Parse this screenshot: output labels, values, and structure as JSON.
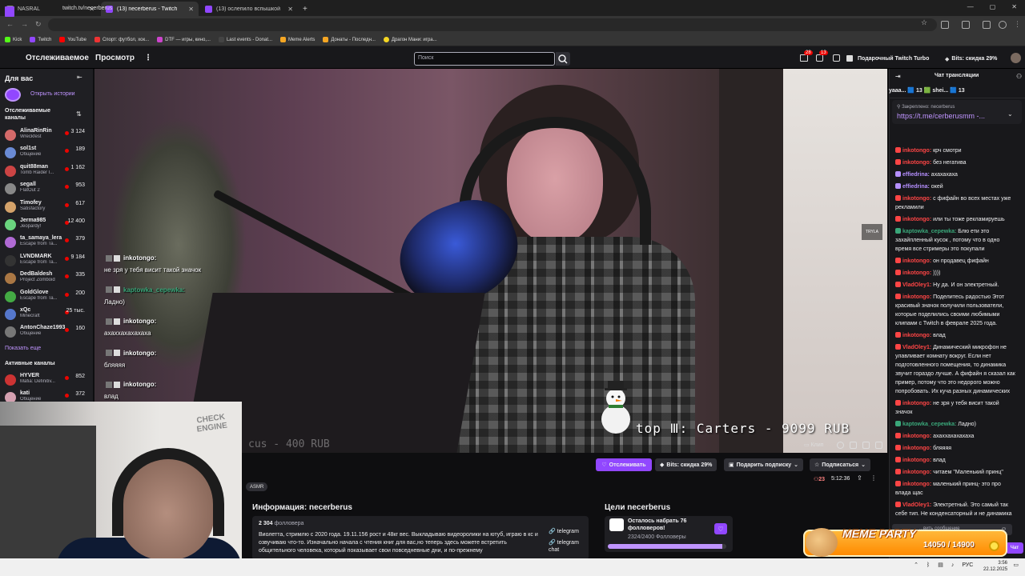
{
  "browser": {
    "tabs": [
      {
        "label": "NASRAL",
        "color": "#888888",
        "active": false
      },
      {
        "label": "(13) necerberus - Twitch",
        "color": "#9147ff",
        "active": true
      },
      {
        "label": "(13) ослепило вспышкой",
        "color": "#9147ff",
        "active": false
      }
    ],
    "new_tab": "+",
    "url": "twitch.tv/necerberus",
    "bookmarks": [
      {
        "label": "Kick",
        "color": "#53fc18"
      },
      {
        "label": "Twitch",
        "color": "#9147ff"
      },
      {
        "label": "YouTube",
        "color": "#ff0000"
      },
      {
        "label": "Спорт: футбол, хок...",
        "color": "#e33"
      },
      {
        "label": "DTF — игры, кино,...",
        "color": "#cc44cc"
      },
      {
        "label": "Last events - Donat...",
        "color": "#444444"
      },
      {
        "label": "Meme Alerts",
        "color": "#f5a623"
      },
      {
        "label": "Донаты - Последн...",
        "color": "#f5a623"
      },
      {
        "label": "Драгон Мани: игра...",
        "color": "#f5d623"
      }
    ]
  },
  "twitch_nav": {
    "following": "Отслеживаемое",
    "browse": "Просмотр",
    "more": "⋮",
    "search_placeholder": "Поиск",
    "notif_count_1": "28",
    "notif_count_2": "13",
    "gift_turbo": "Подарочный Twitch Turbo",
    "bits_discount": "Bits: скидка 29%"
  },
  "sidebar": {
    "title": "Для вас",
    "open_stories": "Открыть истории",
    "followed_label": "Отслеживаемые каналы",
    "channels": [
      {
        "name": "AlinaRinRin",
        "game": "Wreckfest",
        "viewers": "3 124",
        "color": "#d46a6a"
      },
      {
        "name": "sol1st",
        "game": "Общение",
        "viewers": "189",
        "color": "#6a8ad4"
      },
      {
        "name": "quit88man",
        "game": "Tomb Raider I...",
        "viewers": "1 162",
        "color": "#c44"
      },
      {
        "name": "segall",
        "game": "FlatOut 2",
        "viewers": "953",
        "color": "#888"
      },
      {
        "name": "Timofey",
        "game": "Satisfactory",
        "viewers": "617",
        "color": "#d4a26a"
      },
      {
        "name": "Jerma985",
        "game": "Jeopardy!",
        "viewers": "12 400",
        "color": "#6ad47e"
      },
      {
        "name": "ta_samaya_lera",
        "game": "Escape from Ta...",
        "viewers": "379",
        "color": "#b06ad4"
      },
      {
        "name": "LVNDMARK",
        "game": "Escape from Ta...",
        "viewers": "9 184",
        "color": "#333"
      },
      {
        "name": "DedBaldesh",
        "game": "Project Zomboid",
        "viewers": "335",
        "color": "#aa7744"
      },
      {
        "name": "GoldGlove",
        "game": "Escape from Ta...",
        "viewers": "200",
        "color": "#44aa44"
      },
      {
        "name": "xQc",
        "game": "Minecraft",
        "viewers": "25 тыс.",
        "color": "#5577cc"
      },
      {
        "name": "AntonChaze1993",
        "game": "Общение",
        "viewers": "160",
        "color": "#777"
      }
    ],
    "show_more": "Показать еще",
    "active_label": "Активные каналы",
    "active_channels": [
      {
        "name": "HYVER",
        "game": "Mafia: Definitiv...",
        "viewers": "852",
        "color": "#cc3333"
      },
      {
        "name": "kati",
        "game": "Общение",
        "viewers": "372",
        "color": "#d4a0b0"
      }
    ]
  },
  "video": {
    "overlay_chat": [
      {
        "user": "inkotongo:",
        "text": "не зря у тебя висит такой значок",
        "user_color": "#ffffff"
      },
      {
        "user": "kaptowka_cepewka:",
        "text": "Ладно)",
        "user_color": "#3aa77a"
      },
      {
        "user": "inkotongo:",
        "text": "ахаххахахахаха",
        "user_color": "#ffffff"
      },
      {
        "user": "inkotongo:",
        "text": "бляяяя",
        "user_color": "#ffffff"
      },
      {
        "user": "inkotongo:",
        "text": "влад",
        "user_color": "#ffffff"
      }
    ],
    "top_donor": "top Ⅲ:   Carters - 9099 RUB",
    "faded_text": "cus - 400 RUB",
    "watermark": "TRYLA",
    "clip": "Клип"
  },
  "webcam": {
    "logo": "CHECK ENGINE"
  },
  "channel": {
    "tag": "ASMR",
    "follow": "Отслеживать",
    "bits": "Bits: скидка 29%",
    "gift_sub": "Подарить подписку",
    "subscribe": "Подписаться",
    "viewers": "23",
    "uptime": "5:12:36",
    "info_title": "Информация: necerberus",
    "followers_count": "2 304",
    "followers_label": "фолловера",
    "bio": "Виолетта, стримлю с 2020 года. 19.11.156 рост и 48кг вес. Выкладываю видеоролики на ютуб, играю в кс и озвучиваю что-то. Изначально начала с чтения книг для вас,но теперь здесь можете встретить общительного человека, который показывает свои повседневные дни, и по-прежнему",
    "telegram": "telegram",
    "telegram_chat": "telegram chat",
    "goals_title": "Цели necerberus",
    "goal_text": "Осталось набрать 76 фолловеров!",
    "goal_progress": "2324/2400 Фолловеры",
    "goal_fraction": 0.968
  },
  "chat": {
    "title": "Чат трансляции",
    "hype": "yaaa... 🟦 13   🟩 shei... 🟦 13",
    "pinned_label": "Закреплено: necerberus",
    "pinned_link": "https://t.me/cerberusmm -...",
    "messages": [
      {
        "user": "inkotongo:",
        "color": "#ff4545",
        "text": "крч смотри"
      },
      {
        "user": "inkotongo:",
        "color": "#ff4545",
        "text": "без негатива"
      },
      {
        "user": "effiedrina:",
        "color": "#b58fff",
        "text": "ахахахаха"
      },
      {
        "user": "effiedrina:",
        "color": "#b58fff",
        "text": "окей"
      },
      {
        "user": "inkotongo:",
        "color": "#ff4545",
        "text": "с фифайн во всех местах уже рекламили"
      },
      {
        "user": "inkotongo:",
        "color": "#ff4545",
        "text": "или ты тоже рекламируешь"
      },
      {
        "user": "kaptowka_cepewka:",
        "color": "#3aa77a",
        "text": "Блю ети это захайпленный кусок , потому что в одно время все стримеры это покупали"
      },
      {
        "user": "inkotongo:",
        "color": "#ff4545",
        "text": "он продавец фифайн"
      },
      {
        "user": "inkotongo:",
        "color": "#ff4545",
        "text": "))))"
      },
      {
        "user": "VladOley1:",
        "color": "#ff4545",
        "text": "Ну да. И он электретный."
      },
      {
        "user": "inkotongo:",
        "color": "#ff4545",
        "text": "Поделитесь радостью Этот красивый значок получили пользователи, которые поделились своими любимыми клипами с Twitch в феврале 2025 года."
      },
      {
        "user": "inkotongo:",
        "color": "#ff4545",
        "text": "влад"
      },
      {
        "user": "VladOley1:",
        "color": "#ff4545",
        "text": "Динамический микрофон не улавливает комнату вокруг. Если нет подготовленного помещения, то динамика звучит гораздо лучше. А фифайн я сказал как пример, потому что это недорого можно попробовать. Их куча разных динамических"
      },
      {
        "user": "inkotongo:",
        "color": "#ff4545",
        "text": "не зря у тебя висит такой значок"
      },
      {
        "user": "kaptowka_cepewka:",
        "color": "#3aa77a",
        "text": "Ладно)"
      },
      {
        "user": "inkotongo:",
        "color": "#ff4545",
        "text": "ахаххахахахаха"
      },
      {
        "user": "inkotongo:",
        "color": "#ff4545",
        "text": "бляяяя"
      },
      {
        "user": "inkotongo:",
        "color": "#ff4545",
        "text": "влад"
      },
      {
        "user": "inkotongo:",
        "color": "#ff4545",
        "text": "читаем \"Маленький принц\""
      },
      {
        "user": "inkotongo:",
        "color": "#ff4545",
        "text": "маленький принц- это про влада щас"
      },
      {
        "user": "VladOley1:",
        "color": "#ff4545",
        "text": "Электретный. Это самый так себе тип. Не конденсаторный и не динамика"
      }
    ],
    "input_placeholder": "...вить сообщение",
    "send": "Чат"
  },
  "meme_party": {
    "title": "MEME PARTY",
    "value": "14050 / 14900"
  },
  "taskbar": {
    "lang": "РУС",
    "time": "3:56",
    "date": "22.12.2025"
  }
}
